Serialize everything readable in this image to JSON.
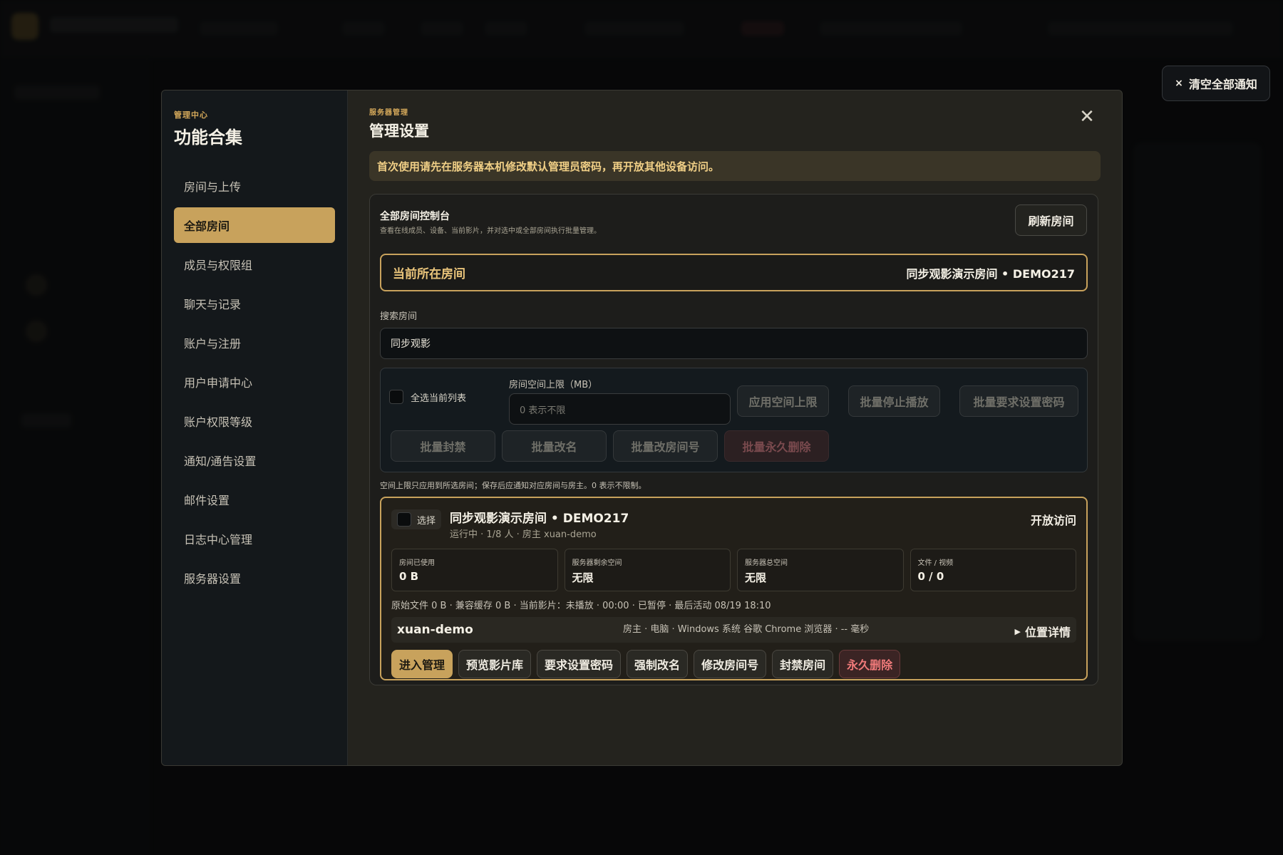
{
  "notification": {
    "clear_all_label": "清空全部通知",
    "close_glyph": "×"
  },
  "sidebar": {
    "eyebrow": "管理中心",
    "title": "功能合集",
    "items": [
      {
        "label": "房间与上传"
      },
      {
        "label": "全部房间",
        "active": true
      },
      {
        "label": "成员与权限组"
      },
      {
        "label": "聊天与记录"
      },
      {
        "label": "账户与注册"
      },
      {
        "label": "用户申请中心"
      },
      {
        "label": "账户权限等级"
      },
      {
        "label": "通知/通告设置"
      },
      {
        "label": "邮件设置"
      },
      {
        "label": "日志中心管理"
      },
      {
        "label": "服务器设置"
      }
    ]
  },
  "main": {
    "eyebrow": "服务器管理",
    "title": "管理设置",
    "close_glyph": "✕",
    "warning": "首次使用请先在服务器本机修改默认管理员密码，再开放其他设备访问。"
  },
  "console": {
    "title": "全部房间控制台",
    "subtitle": "查看在线成员、设备、当前影片，并对选中或全部房间执行批量管理。",
    "refresh_label": "刷新房间",
    "current_room_label": "当前所在房间",
    "current_room_value": "同步观影演示房间 • DEMO217",
    "search_label": "搜索房间",
    "search_value": "同步观影"
  },
  "batch": {
    "select_all_label": "全选当前列表",
    "quota_label": "房间空间上限（MB）",
    "quota_placeholder": "0 表示不限",
    "apply_quota": "应用空间上限",
    "batch_stop": "批量停止播放",
    "batch_require_password": "批量要求设置密码",
    "batch_ban": "批量封禁",
    "batch_rename": "批量改名",
    "batch_change_number": "批量改房间号",
    "batch_delete": "批量永久删除",
    "hint": "空间上限只应用到所选房间；保存后应通知对应房间与房主。0 表示不限制。"
  },
  "room": {
    "select_label": "选择",
    "name": "同步观影演示房间 • DEMO217",
    "meta": "运行中 · 1/8 人 · 房主 xuan-demo",
    "access": "开放访问",
    "stats": [
      {
        "key": "房间已使用",
        "value": "0 B"
      },
      {
        "key": "服务器剩余空间",
        "value": "无限"
      },
      {
        "key": "服务器总空间",
        "value": "无限"
      },
      {
        "key": "文件 / 视频",
        "value": "0 / 0"
      }
    ],
    "detail": "原始文件 0 B · 兼容缓存 0 B · 当前影片：未播放 · 00:00 · 已暂停 · 最后活动 08/19 18:10",
    "owner_name": "xuan-demo",
    "owner_device": "房主 · 电脑 · Windows 系统 谷歌 Chrome 浏览器 · -- 毫秒",
    "location_label": "位置详情",
    "actions": {
      "enter": "进入管理",
      "preview": "预览影片库",
      "require_password": "要求设置密码",
      "force_rename": "强制改名",
      "change_number": "修改房间号",
      "ban": "封禁房间",
      "delete": "永久删除"
    }
  },
  "colors": {
    "accent": "#c8a25c",
    "danger": "#f07a7a",
    "warning_text": "#f0cf86"
  }
}
